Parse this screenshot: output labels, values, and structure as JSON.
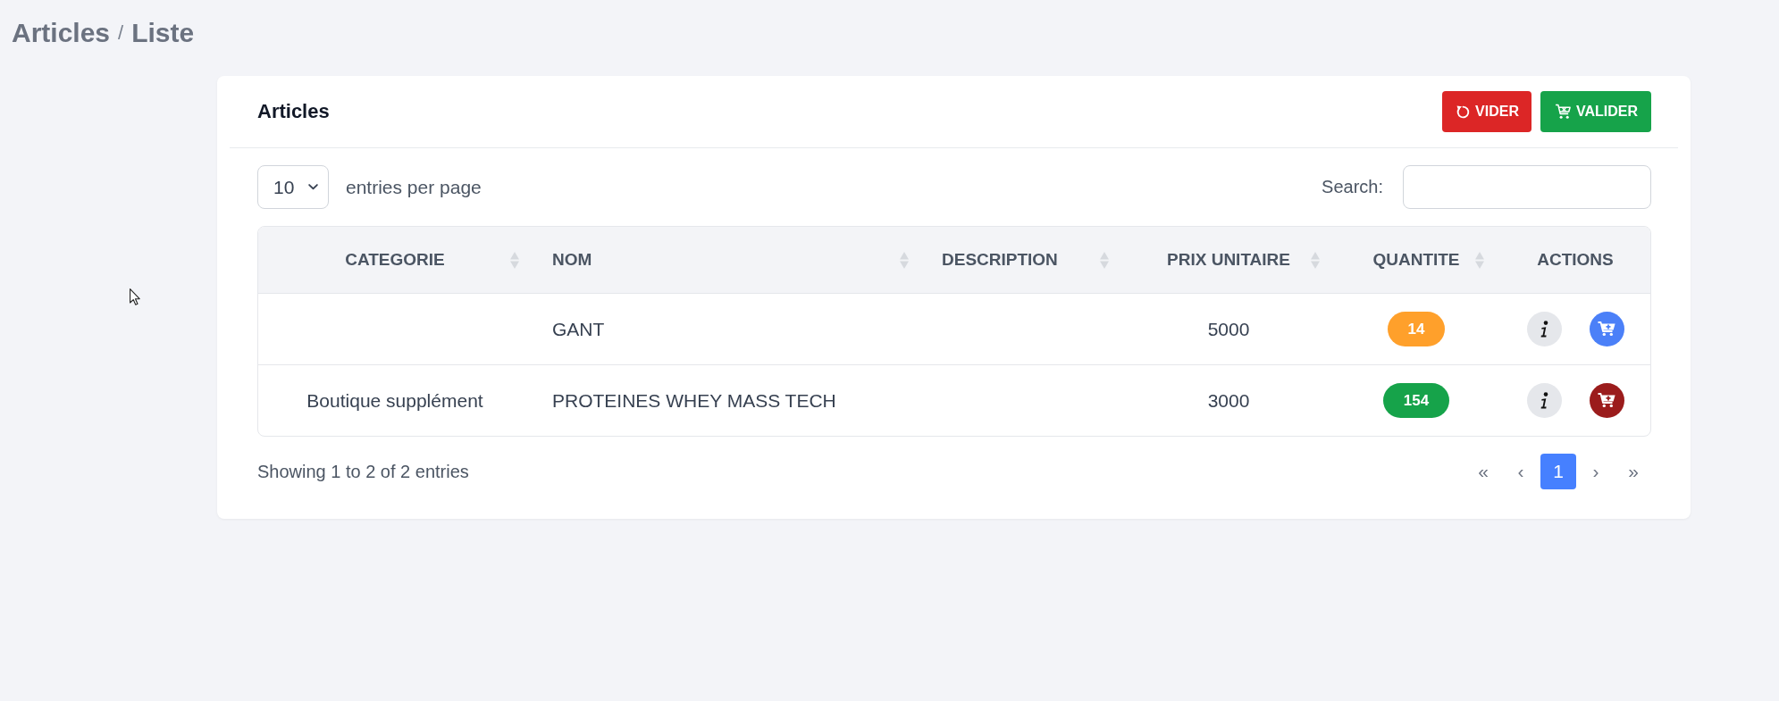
{
  "breadcrumb": {
    "items": [
      "Articles",
      "Liste"
    ],
    "separator": "/"
  },
  "card": {
    "title": "Articles",
    "buttons": [
      {
        "label": "VIDER",
        "kind": "danger"
      },
      {
        "label": "VALIDER",
        "kind": "success"
      }
    ]
  },
  "length_menu": {
    "value": "10",
    "label": "entries per page"
  },
  "search": {
    "label": "Search:"
  },
  "table": {
    "columns": [
      {
        "label": "CATEGORIE",
        "sortable": true
      },
      {
        "label": "NOM",
        "sortable": true
      },
      {
        "label": "DESCRIPTION",
        "sortable": true
      },
      {
        "label": "PRIX UNITAIRE",
        "sortable": true
      },
      {
        "label": "QUANTITE",
        "sortable": true
      },
      {
        "label": "ACTIONS",
        "sortable": false
      }
    ],
    "rows": [
      {
        "name": "GANT",
        "unit_price": "5000",
        "quantity": {
          "text": "14",
          "color": "#ffa02b"
        },
        "actions": [
          {
            "kind": "info"
          },
          {
            "kind": "cart",
            "color": "#4b80f8"
          }
        ]
      },
      {
        "category": "Boutique supplément",
        "name": "PROTEINES WHEY MASS TECH",
        "unit_price": "3000",
        "quantity": {
          "text": "154",
          "color": "#16a34a"
        },
        "actions": [
          {
            "kind": "info"
          },
          {
            "kind": "cart",
            "color": "#9b1c1c"
          }
        ]
      }
    ]
  },
  "footer": {
    "info": "Showing 1 to 2 of 2 entries",
    "pagination": [
      {
        "label": "«",
        "selected": false
      },
      {
        "label": "‹",
        "selected": false
      },
      {
        "label": "1",
        "selected": true
      },
      {
        "label": "›",
        "selected": false
      },
      {
        "label": "»",
        "selected": false
      }
    ]
  }
}
